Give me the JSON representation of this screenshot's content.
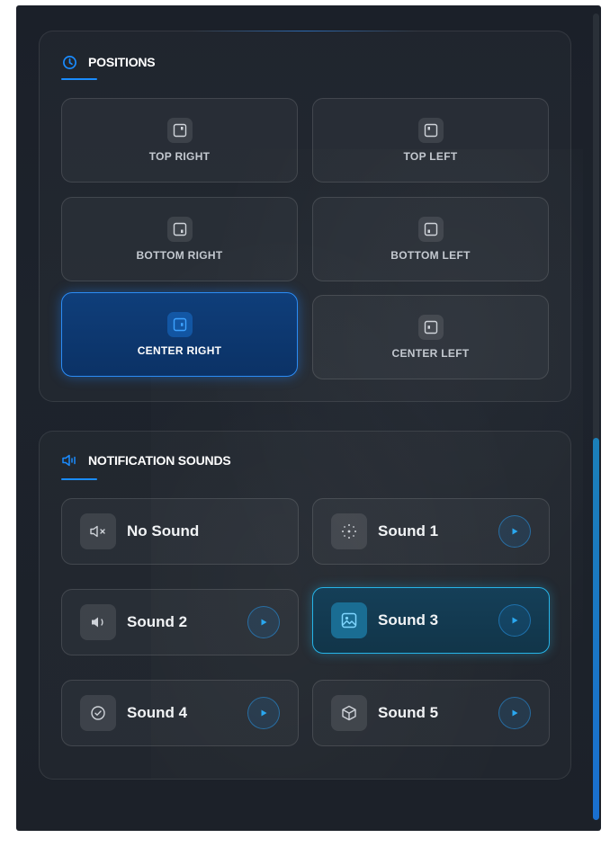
{
  "positions": {
    "title": "POSITIONS",
    "items": [
      {
        "label": "TOP RIGHT"
      },
      {
        "label": "TOP LEFT"
      },
      {
        "label": "BOTTOM RIGHT"
      },
      {
        "label": "BOTTOM LEFT"
      },
      {
        "label": "CENTER RIGHT"
      },
      {
        "label": "CENTER LEFT"
      }
    ],
    "selected": "CENTER RIGHT"
  },
  "sounds": {
    "title": "NOTIFICATION SOUNDS",
    "items": [
      {
        "label": "No Sound",
        "icon": "mute-icon"
      },
      {
        "label": "Sound 1",
        "icon": "sparkle-icon"
      },
      {
        "label": "Sound 2",
        "icon": "speaker-icon"
      },
      {
        "label": "Sound 3",
        "icon": "image-icon"
      },
      {
        "label": "Sound 4",
        "icon": "check-circle-icon"
      },
      {
        "label": "Sound 5",
        "icon": "cube-icon"
      }
    ],
    "selected": "Sound 3"
  },
  "colors": {
    "accent": "#1a8cff",
    "sound_accent": "#26b4e8",
    "background": "#1c2129"
  }
}
